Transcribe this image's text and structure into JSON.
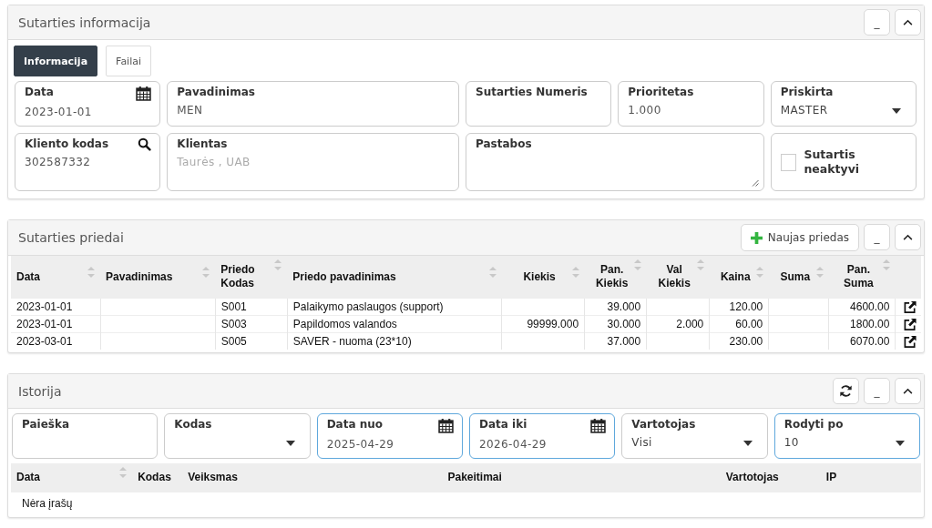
{
  "contract": {
    "title": "Sutarties informacija",
    "buttons": [
      {
        "kind": "minimize",
        "label": "_"
      },
      {
        "kind": "collapse"
      }
    ],
    "tabs": [
      {
        "label": "Informacija",
        "selected": true
      },
      {
        "label": "Failai",
        "selected": false
      }
    ],
    "fields": [
      {
        "kind": "date",
        "label": "Data",
        "value": "2023-01-01"
      },
      {
        "kind": "text",
        "label": "Pavadinimas",
        "value": "MEN"
      },
      {
        "kind": "text",
        "label": "Sutarties Numeris"
      },
      {
        "kind": "text",
        "label": "Prioritetas",
        "value": "1.000"
      },
      {
        "kind": "select",
        "label": "Priskirta",
        "value": "MASTER"
      },
      {
        "kind": "search",
        "label": "Kliento kodas",
        "value": "302587332"
      },
      {
        "kind": "readonly",
        "label": "Klientas",
        "value": "Taurės , UAB"
      },
      {
        "kind": "textarea",
        "label": "Pastabos"
      },
      {
        "kind": "checkbox",
        "label": "Sutartis neaktyvi",
        "checked": false
      }
    ]
  },
  "attachments": {
    "title": "Sutarties priedai",
    "buttons": [
      {
        "kind": "add",
        "label": "Naujas priedas"
      },
      {
        "kind": "minimize",
        "label": "_"
      },
      {
        "kind": "collapse"
      }
    ],
    "table": {
      "columns": [
        {
          "label": "Data",
          "kind": "text",
          "sortable": true
        },
        {
          "label": "Pavadinimas",
          "kind": "text",
          "sortable": true
        },
        {
          "label": "Priedo Kodas",
          "kind": "text",
          "sortable": true
        },
        {
          "label": "Priedo pavadinimas",
          "kind": "text",
          "sortable": true
        },
        {
          "label": "Kiekis",
          "kind": "number",
          "sortable": true
        },
        {
          "label": "Pan. Kiekis",
          "kind": "number",
          "sortable": true
        },
        {
          "label": "Val Kiekis",
          "kind": "number",
          "sortable": true
        },
        {
          "label": "Kaina",
          "kind": "number",
          "sortable": true
        },
        {
          "label": "Suma",
          "kind": "number",
          "sortable": true
        },
        {
          "label": "Pan. Suma",
          "kind": "number",
          "sortable": true
        },
        {
          "kind": "action"
        }
      ],
      "rows": [
        {
          "cells": [
            "2023-01-01",
            null,
            "S001",
            "Palaikymo paslaugos (support)",
            null,
            "39.000",
            null,
            "120.00",
            null,
            "4600.00"
          ]
        },
        {
          "cells": [
            "2023-01-01",
            null,
            "S003",
            "Papildomos valandos",
            "99999.000",
            "30.000",
            "2.000",
            "60.00",
            null,
            "1800.00"
          ]
        },
        {
          "cells": [
            "2023-03-01",
            null,
            "S005",
            "SAVER - nuoma (23*10)",
            null,
            "37.000",
            null,
            "230.00",
            null,
            "6070.00"
          ]
        }
      ]
    }
  },
  "history": {
    "title": "Istorija",
    "buttons": [
      {
        "kind": "refresh"
      },
      {
        "kind": "minimize",
        "label": "_"
      },
      {
        "kind": "collapse"
      }
    ],
    "filters": [
      {
        "kind": "text",
        "label": "Paieška",
        "highlighted": false
      },
      {
        "kind": "select",
        "label": "Kodas",
        "highlighted": false
      },
      {
        "kind": "date",
        "label": "Data nuo",
        "value": "2025-04-29",
        "highlighted": true
      },
      {
        "kind": "date",
        "label": "Data iki",
        "value": "2026-04-29",
        "highlighted": true
      },
      {
        "kind": "select",
        "label": "Vartotojas",
        "value": "Visi",
        "highlighted": false
      },
      {
        "kind": "select",
        "label": "Rodyti po",
        "value": "10",
        "highlighted": true
      }
    ],
    "table": {
      "columns": [
        {
          "label": "Data",
          "kind": "text",
          "sortable": true
        },
        {
          "label": "Kodas",
          "kind": "text",
          "sortable": false
        },
        {
          "label": "Veiksmas",
          "kind": "text",
          "sortable": false
        },
        {
          "label": "Pakeitimai",
          "kind": "text",
          "sortable": false
        },
        {
          "label": "Vartotojas",
          "kind": "text",
          "sortable": false
        },
        {
          "label": "IP",
          "kind": "text",
          "sortable": false
        }
      ],
      "empty_message": "Nėra įrašų"
    }
  }
}
